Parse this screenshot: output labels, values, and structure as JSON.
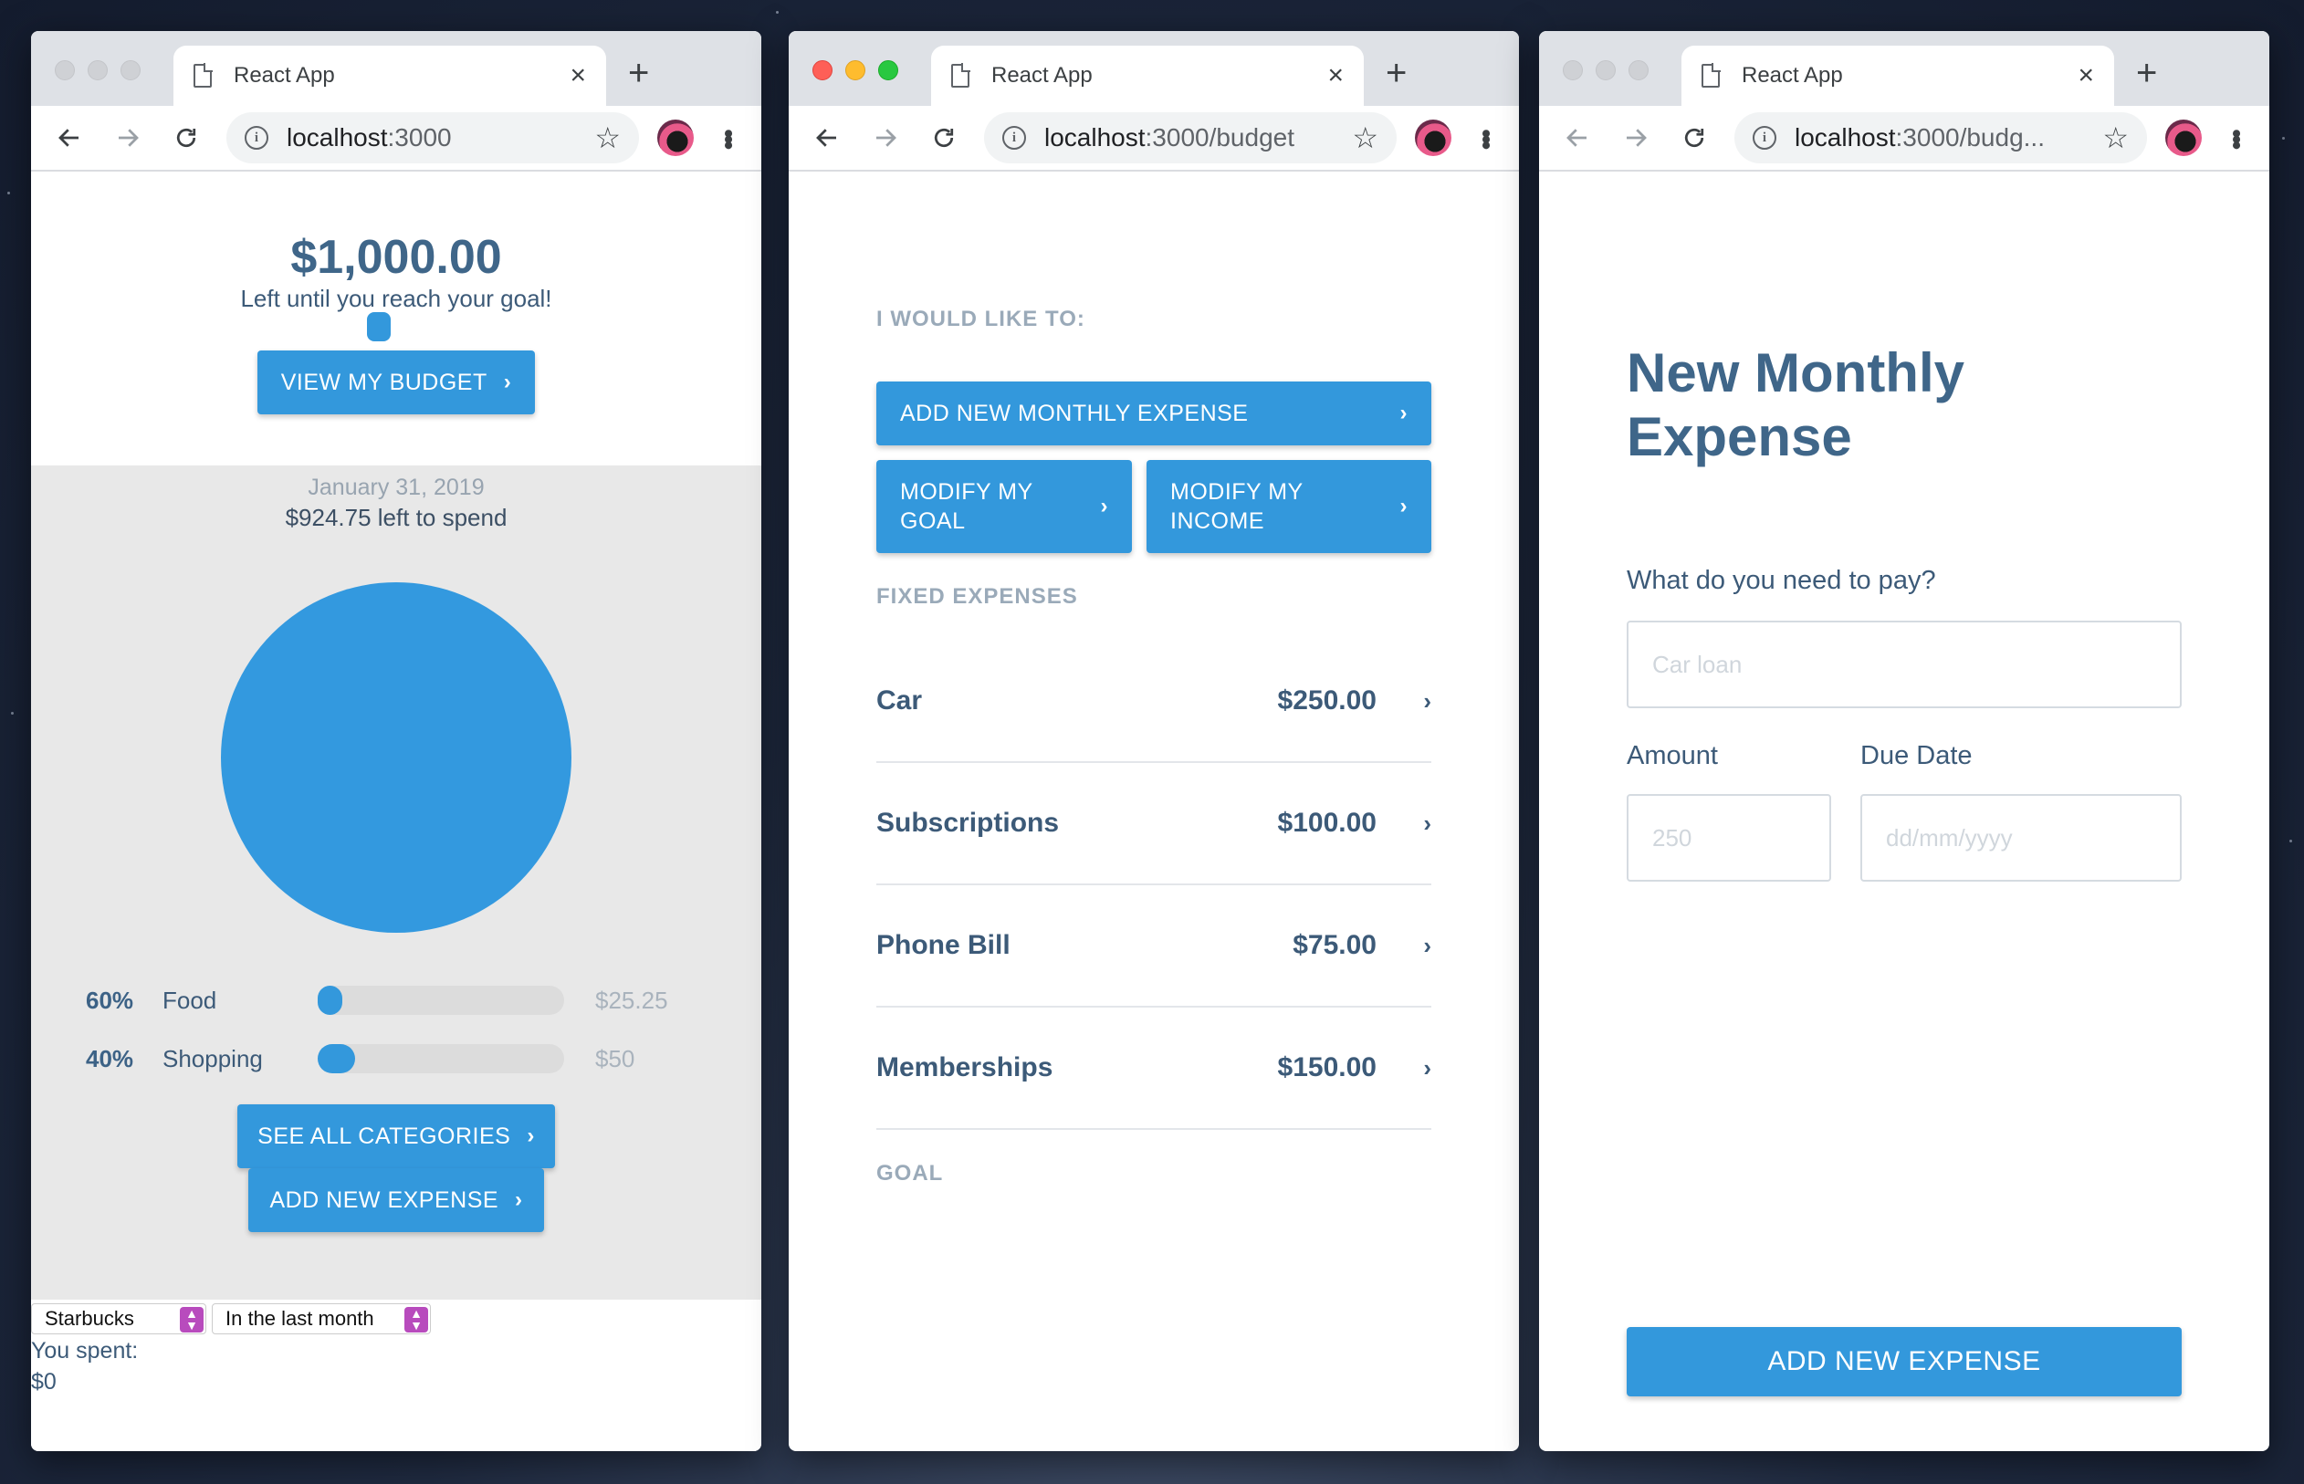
{
  "windows": [
    {
      "tab_title": "React App",
      "url_host": "localhost",
      "url_path": ":3000",
      "dashboard": {
        "amount": "$1,000.00",
        "subtitle": "Left until you reach your goal!",
        "view_budget_label": "VIEW MY BUDGET",
        "date": "January 31, 2019",
        "left_to_spend": "$924.75 left to spend",
        "categories": [
          {
            "percent": "60%",
            "name": "Food",
            "amount": "$25.25",
            "fill_fraction": 0.1
          },
          {
            "percent": "40%",
            "name": "Shopping",
            "amount": "$50",
            "fill_fraction": 0.15
          }
        ],
        "see_all_label": "SEE ALL CATEGORIES",
        "add_expense_label": "ADD NEW EXPENSE",
        "store_select": "Starbucks",
        "range_select": "In the last month",
        "you_spent_label": "You spent:",
        "you_spent_value": "$0"
      }
    },
    {
      "tab_title": "React App",
      "url_host": "localhost",
      "url_path": ":3000/budget",
      "budget": {
        "intent_label": "I WOULD LIKE TO:",
        "add_monthly_label": "ADD NEW MONTHLY EXPENSE",
        "modify_goal_line1": "MODIFY MY",
        "modify_goal_line2": "GOAL",
        "modify_income_line1": "MODIFY MY",
        "modify_income_line2": "INCOME",
        "fixed_label": "FIXED EXPENSES",
        "expenses": [
          {
            "name": "Car",
            "amount": "$250.00"
          },
          {
            "name": "Subscriptions",
            "amount": "$100.00"
          },
          {
            "name": "Phone Bill",
            "amount": "$75.00"
          },
          {
            "name": "Memberships",
            "amount": "$150.00"
          }
        ],
        "goal_label": "GOAL"
      }
    },
    {
      "tab_title": "React App",
      "url_host": "localhost",
      "url_path": ":3000/budg...",
      "form": {
        "title_line1": "New Monthly",
        "title_line2": "Expense",
        "question": "What do you need to pay?",
        "name_placeholder": "Car loan",
        "amount_label": "Amount",
        "amount_placeholder": "250",
        "due_label": "Due Date",
        "due_placeholder": "dd/mm/yyyy",
        "submit_label": "ADD NEW EXPENSE"
      }
    }
  ],
  "colors": {
    "accent": "#3398dc",
    "heading": "#3f6689",
    "text": "#3c5a78",
    "muted": "#9aaab9"
  }
}
